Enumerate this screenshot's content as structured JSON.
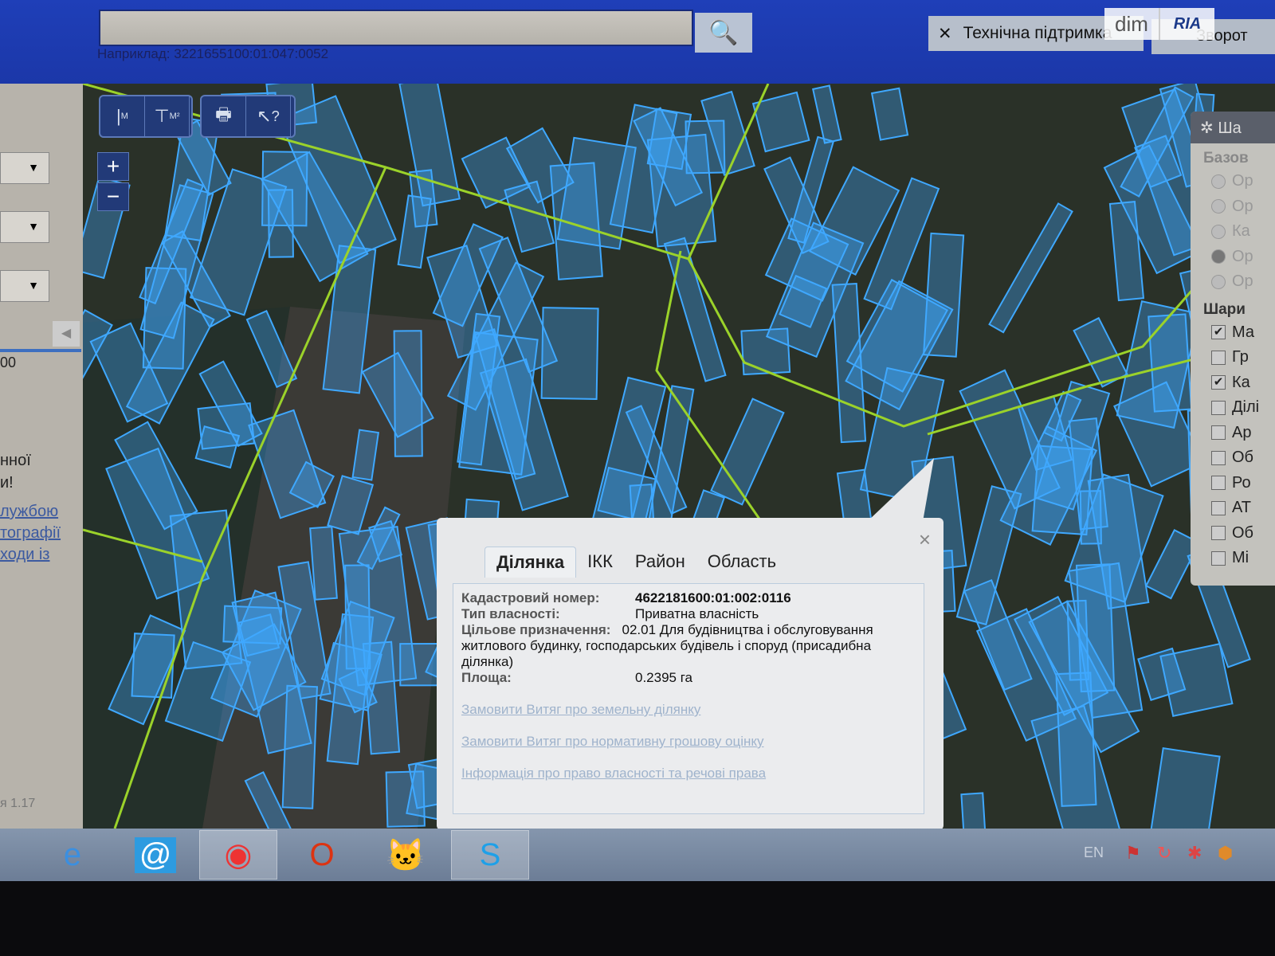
{
  "header": {
    "search_value": "",
    "search_hint": "Наприклад: 3221655100:01:047:0052",
    "support_label": "Технічна підтримка",
    "feedback_label": "Зворот",
    "logo": "dim RIA"
  },
  "left_panel": {
    "text_lines": [
      "00",
      "нної",
      "и!"
    ],
    "links": [
      "лужбою",
      "тографії",
      "ходи   із"
    ],
    "version": "я 1.17"
  },
  "map_tools": {
    "icons": [
      "measure-length-icon",
      "measure-area-icon",
      "print-icon",
      "identify-icon"
    ],
    "labels": [
      "M",
      "M²",
      "?"
    ],
    "zoom_in": "+",
    "zoom_out": "−"
  },
  "layers_panel": {
    "title": "Ша",
    "base_title": "Базов",
    "base_options": [
      {
        "label": "Ор",
        "selected": false
      },
      {
        "label": "Ор",
        "selected": false
      },
      {
        "label": "Ка",
        "selected": false
      },
      {
        "label": "Ор",
        "selected": true
      },
      {
        "label": "Ор",
        "selected": false
      }
    ],
    "layers_title": "Шари",
    "layers": [
      {
        "label": "Ма",
        "checked": true
      },
      {
        "label": "Гр",
        "checked": false
      },
      {
        "label": "Ка",
        "checked": true
      },
      {
        "label": "Ділі",
        "checked": false
      },
      {
        "label": "Ар",
        "checked": false
      },
      {
        "label": "Об",
        "checked": false
      },
      {
        "label": "Ро",
        "checked": false
      },
      {
        "label": "АТ",
        "checked": false
      },
      {
        "label": "Об",
        "checked": false
      },
      {
        "label": "Мі",
        "checked": false
      }
    ]
  },
  "popup": {
    "tabs": [
      "Ділянка",
      "ІКК",
      "Район",
      "Область"
    ],
    "active_tab": "Ділянка",
    "fields": [
      {
        "key": "Кадастровий номер:",
        "value": "4622181600:01:002:0116"
      },
      {
        "key": "Тип власності:",
        "value": "Приватна власність"
      },
      {
        "key": "Цільове призначення:",
        "value": "02.01 Для будівництва і обслуговування житлового будинку, господарських будівель і споруд (присадибна ділянка)"
      },
      {
        "key": "Площа:",
        "value": "0.2395 га"
      }
    ],
    "links": [
      "Замовити Витяг про земельну ділянку",
      "Замовити Витяг про нормативну грошову оцінку",
      "Інформація про право власності та речові права"
    ],
    "close": "×"
  },
  "taskbar": {
    "apps": [
      "explorer",
      "internet-explorer",
      "mail",
      "chrome",
      "opera",
      "scratch",
      "skype"
    ],
    "lang": "EN"
  },
  "colors": {
    "header": "#1f3fb8",
    "parcel": "#3fa8ff",
    "road": "#9bd22a"
  }
}
